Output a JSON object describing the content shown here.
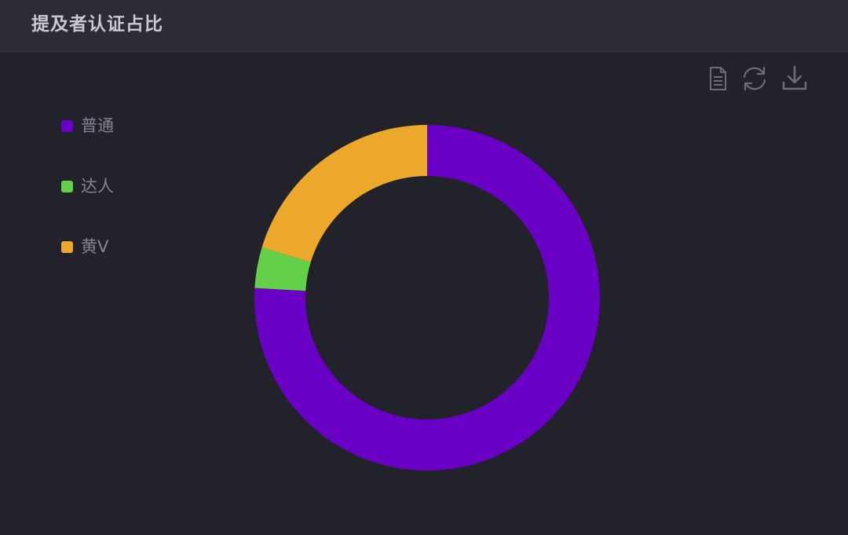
{
  "header": {
    "title": "提及者认证占比"
  },
  "toolbox": [
    {
      "name": "data-view-icon"
    },
    {
      "name": "refresh-icon"
    },
    {
      "name": "download-icon"
    }
  ],
  "chart_data": {
    "type": "pie",
    "donut": true,
    "categories": [
      "普通",
      "达人",
      "黄V"
    ],
    "values": [
      75.9,
      3.8,
      20.3
    ],
    "colors": [
      "#6a00c6",
      "#64cf48",
      "#eba82b"
    ],
    "legend_position": "top-left",
    "start_angle_deg": 90,
    "clockwise": true
  }
}
